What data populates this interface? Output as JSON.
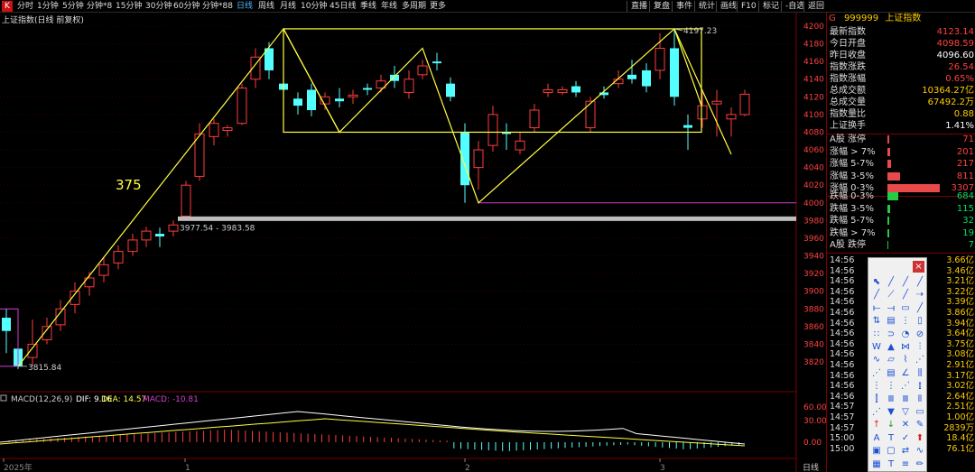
{
  "toolbar": {
    "logo": "K",
    "tabs": [
      "分时",
      "1分钟",
      "5分钟",
      "分钟*8",
      "15分钟",
      "30分钟",
      "60分钟",
      "分钟*88",
      "日线",
      "周线",
      "月线",
      "10分钟",
      "45日线",
      "季线",
      "年线",
      "多周期",
      "更多"
    ],
    "active_tab": "日线",
    "right_tabs": [
      "直播",
      "复盘",
      "事件",
      "统计",
      "画线",
      "F10",
      "标记",
      "-自选",
      "返回"
    ]
  },
  "chart_title": "上证指数(日线 前复权)",
  "chart": {
    "label_375": "375",
    "high_label": "4197.23",
    "low_label": "3815.84",
    "gap_label": "3977.54 - 3983.58",
    "price_axis": [
      "4200",
      "4180",
      "4160",
      "4140",
      "4120",
      "4100",
      "4080",
      "4060",
      "4040",
      "4020",
      "4000",
      "3980",
      "3960",
      "3940",
      "3920",
      "3900",
      "3880",
      "3860",
      "3840",
      "3820"
    ],
    "macd_label": "MACD(12,26,9)",
    "dif": "DIF: 9.16",
    "dea": "DEA: 14.57",
    "macd": "MACD: -10.81",
    "macd_axis": [
      "60.00",
      "30.00",
      "0.00"
    ],
    "x_labels": [
      "2025年",
      "1",
      "2",
      "3"
    ],
    "period_label": "日线"
  },
  "info": {
    "code_prefix": "G",
    "code": "999999",
    "name": "上证指数",
    "rows": [
      {
        "k": "最新指数",
        "v": "4123.14",
        "c": "red"
      },
      {
        "k": "今日开盘",
        "v": "4098.59",
        "c": "red"
      },
      {
        "k": "昨日收盘",
        "v": "4096.60",
        "c": "white"
      },
      {
        "k": "指数涨跌",
        "v": "26.54",
        "c": "red"
      },
      {
        "k": "指数涨幅",
        "v": "0.65%",
        "c": "red"
      },
      {
        "k": "总成交额",
        "v": "10364.27亿",
        "c": "yellow"
      },
      {
        "k": "总成交量",
        "v": "67492.2万",
        "c": "yellow"
      },
      {
        "k": "指数量比",
        "v": "0.88",
        "c": "yellow"
      },
      {
        "k": "上证换手",
        "v": "1.41%",
        "c": "white"
      }
    ],
    "dist_up": [
      {
        "k": "A股 涨停",
        "v": "71"
      },
      {
        "k": "涨幅 > 7%",
        "v": "201"
      },
      {
        "k": "涨幅 5-7%",
        "v": "217"
      },
      {
        "k": "涨幅 3-5%",
        "v": "811"
      },
      {
        "k": "涨幅 0-3%",
        "v": "3307"
      }
    ],
    "dist_down": [
      {
        "k": "跌幅 0-3%",
        "v": "684"
      },
      {
        "k": "跌幅 3-5%",
        "v": "115"
      },
      {
        "k": "跌幅 5-7%",
        "v": "32"
      },
      {
        "k": "跌幅 > 7%",
        "v": "19"
      },
      {
        "k": "A股 跌停",
        "v": "7"
      }
    ],
    "ticks": [
      {
        "t": "14:56",
        "a": "3.66亿"
      },
      {
        "t": "14:56",
        "a": "3.46亿"
      },
      {
        "t": "14:56",
        "a": "3.21亿"
      },
      {
        "t": "14:56",
        "a": "3.22亿"
      },
      {
        "t": "14:56",
        "a": "3.39亿"
      },
      {
        "t": "14:56",
        "a": "3.86亿"
      },
      {
        "t": "14:56",
        "a": "3.94亿"
      },
      {
        "t": "14:56",
        "a": "3.64亿"
      },
      {
        "t": "14:56",
        "a": "3.75亿"
      },
      {
        "t": "14:56",
        "a": "3.08亿"
      },
      {
        "t": "14:56",
        "a": "2.91亿"
      },
      {
        "t": "14:56",
        "a": "3.17亿"
      },
      {
        "t": "14:56",
        "a": "3.02亿"
      },
      {
        "t": "14:56",
        "a": "2.64亿"
      },
      {
        "t": "14:57",
        "a": "2.51亿"
      },
      {
        "t": "14:57",
        "a": "1.00亿"
      },
      {
        "t": "14:57",
        "a": "2839万"
      },
      {
        "t": "15:00",
        "a": "18.4亿"
      },
      {
        "t": "15:00",
        "a": "76.1亿"
      }
    ]
  },
  "tools": {
    "close": "×",
    "icons": [
      "⬉",
      "╱",
      "╱",
      "╱",
      "╱",
      "⟋",
      "╱",
      "⇢",
      "⟝",
      "⟞",
      "▭",
      "╱",
      "⇅",
      "▤",
      "⋮",
      "▯",
      "∷",
      "⊃",
      "◔",
      "⊘",
      "W",
      "▲",
      "⋈",
      "⫶",
      "∿",
      "▱",
      "⌇",
      "⋰",
      "⋰",
      "▤",
      "∠",
      "⫼",
      "⋮",
      "⋮",
      "⋰",
      "⫾",
      "⫿",
      "Ⅲ",
      "Ⅲ",
      "⦀",
      "⋰",
      "▼",
      "▽",
      "▭",
      "↑",
      "↓",
      "✕",
      "✎",
      "A",
      "T",
      "✓",
      "⬆",
      "▣",
      "▢",
      "⇄",
      "∿",
      "▦",
      "T",
      "≡",
      "✏"
    ]
  }
}
